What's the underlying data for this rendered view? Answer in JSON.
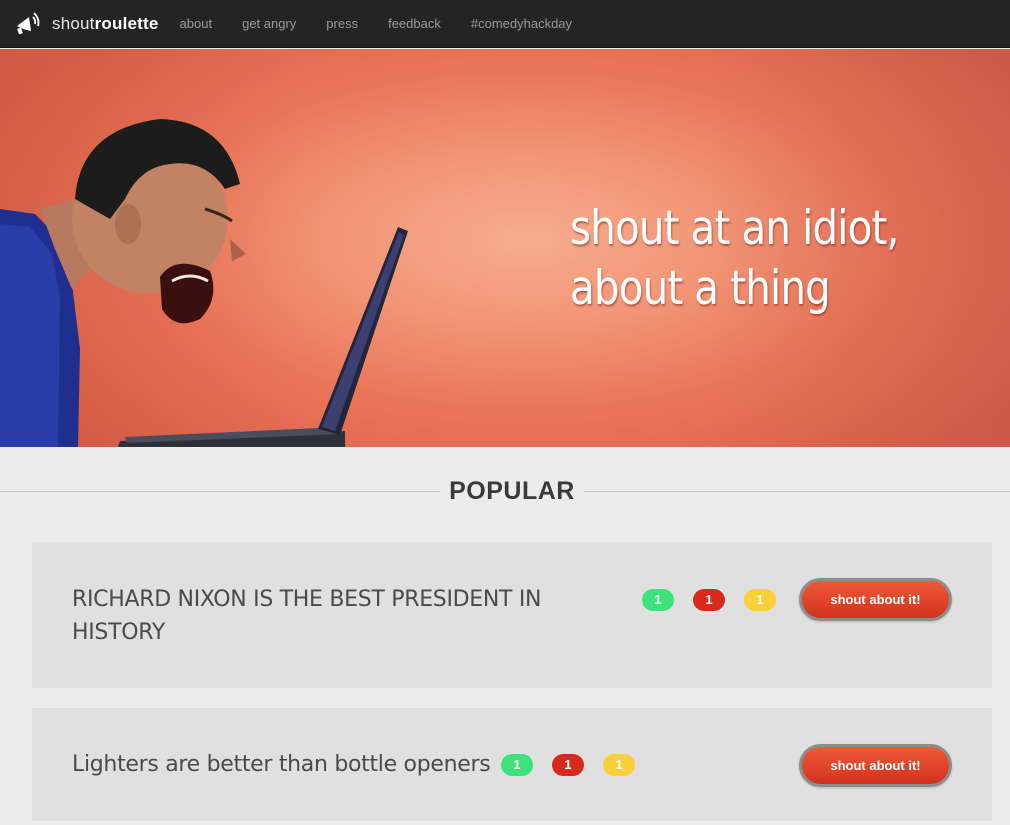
{
  "navbar": {
    "brand_light": "shout",
    "brand_bold": "roulette",
    "logo_icon": "megaphone-icon",
    "links": [
      "about",
      "get angry",
      "press",
      "feedback",
      "#comedyhackday"
    ]
  },
  "hero": {
    "tagline_line1": "shout at an idiot,",
    "tagline_line2": "about a thing",
    "image": "man-yelling-at-laptop"
  },
  "section": {
    "title": "POPULAR"
  },
  "topics": [
    {
      "title": "Richard Nixon is the best president in history",
      "votes": {
        "green": "1",
        "red": "1",
        "yellow": "1"
      },
      "button_label": "shout about it!"
    },
    {
      "title": "Lighters are better than bottle openers",
      "votes": {
        "green": "1",
        "red": "1",
        "yellow": "1"
      },
      "button_label": "shout about it!"
    }
  ],
  "colors": {
    "navbar_bg": "#242424",
    "hero_bg": "#ef8a6a",
    "badge_green": "#3ee27a",
    "badge_red": "#d8291c",
    "badge_yellow": "#f9cf3a",
    "button": "#e0442a"
  }
}
